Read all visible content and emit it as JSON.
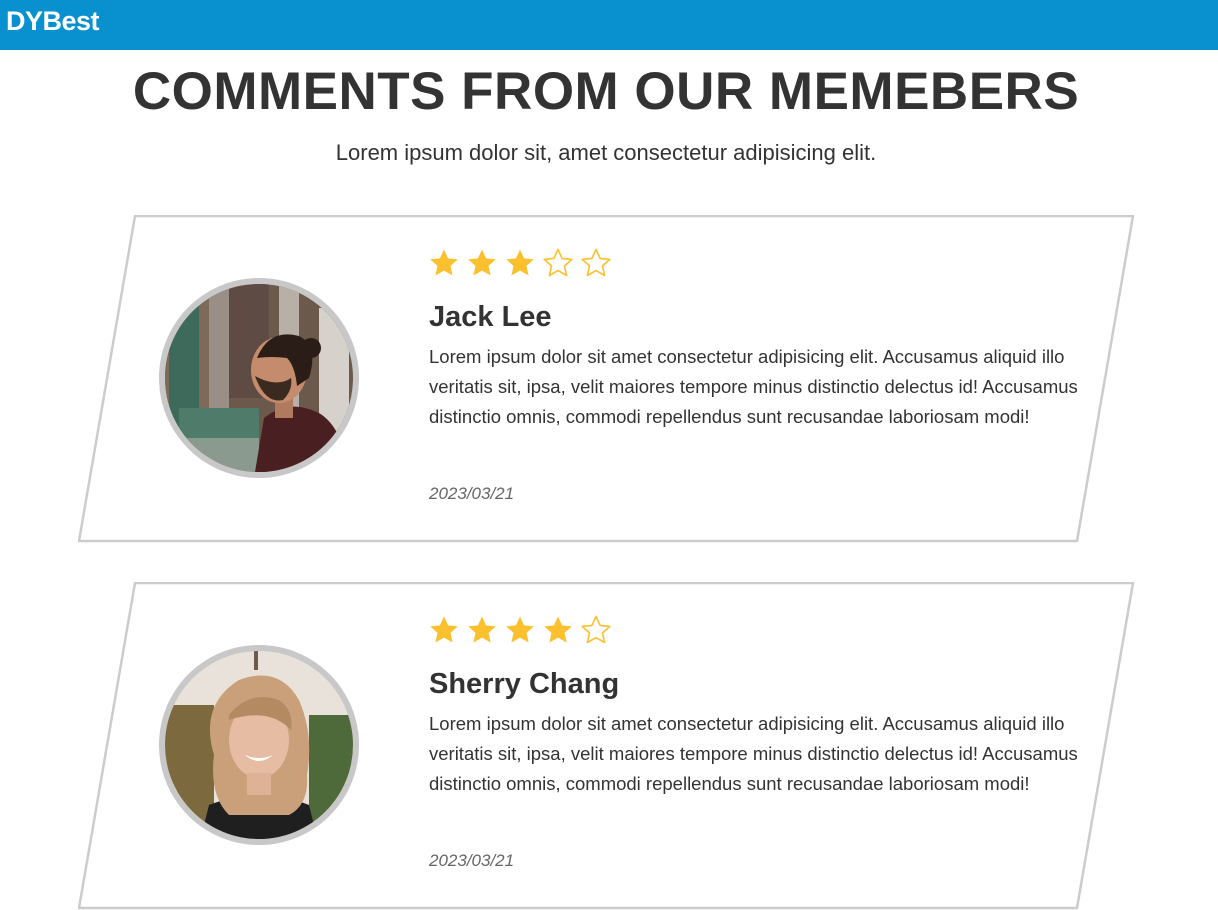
{
  "brand": "DYBest",
  "heading": "COMMENTS FROM OUR MEMEBERS",
  "subheading": "Lorem ipsum dolor sit, amet consectetur adipisicing elit.",
  "star_color": "#fbc02d",
  "outline_color": "#cccccc",
  "comments": [
    {
      "name": "Jack Lee",
      "rating": 3,
      "max_rating": 5,
      "text": "Lorem ipsum dolor sit amet consectetur adipisicing elit. Accusamus aliquid illo veritatis sit, ipsa, velit maiores tempore minus distinctio delectus id! Accusamus distinctio omnis, commodi repellendus sunt recusandae laboriosam modi!",
      "date": "2023/03/21"
    },
    {
      "name": "Sherry Chang",
      "rating": 4,
      "max_rating": 5,
      "text": "Lorem ipsum dolor sit amet consectetur adipisicing elit. Accusamus aliquid illo veritatis sit, ipsa, velit maiores tempore minus distinctio delectus id! Accusamus distinctio omnis, commodi repellendus sunt recusandae laboriosam modi!",
      "date": "2023/03/21"
    }
  ]
}
